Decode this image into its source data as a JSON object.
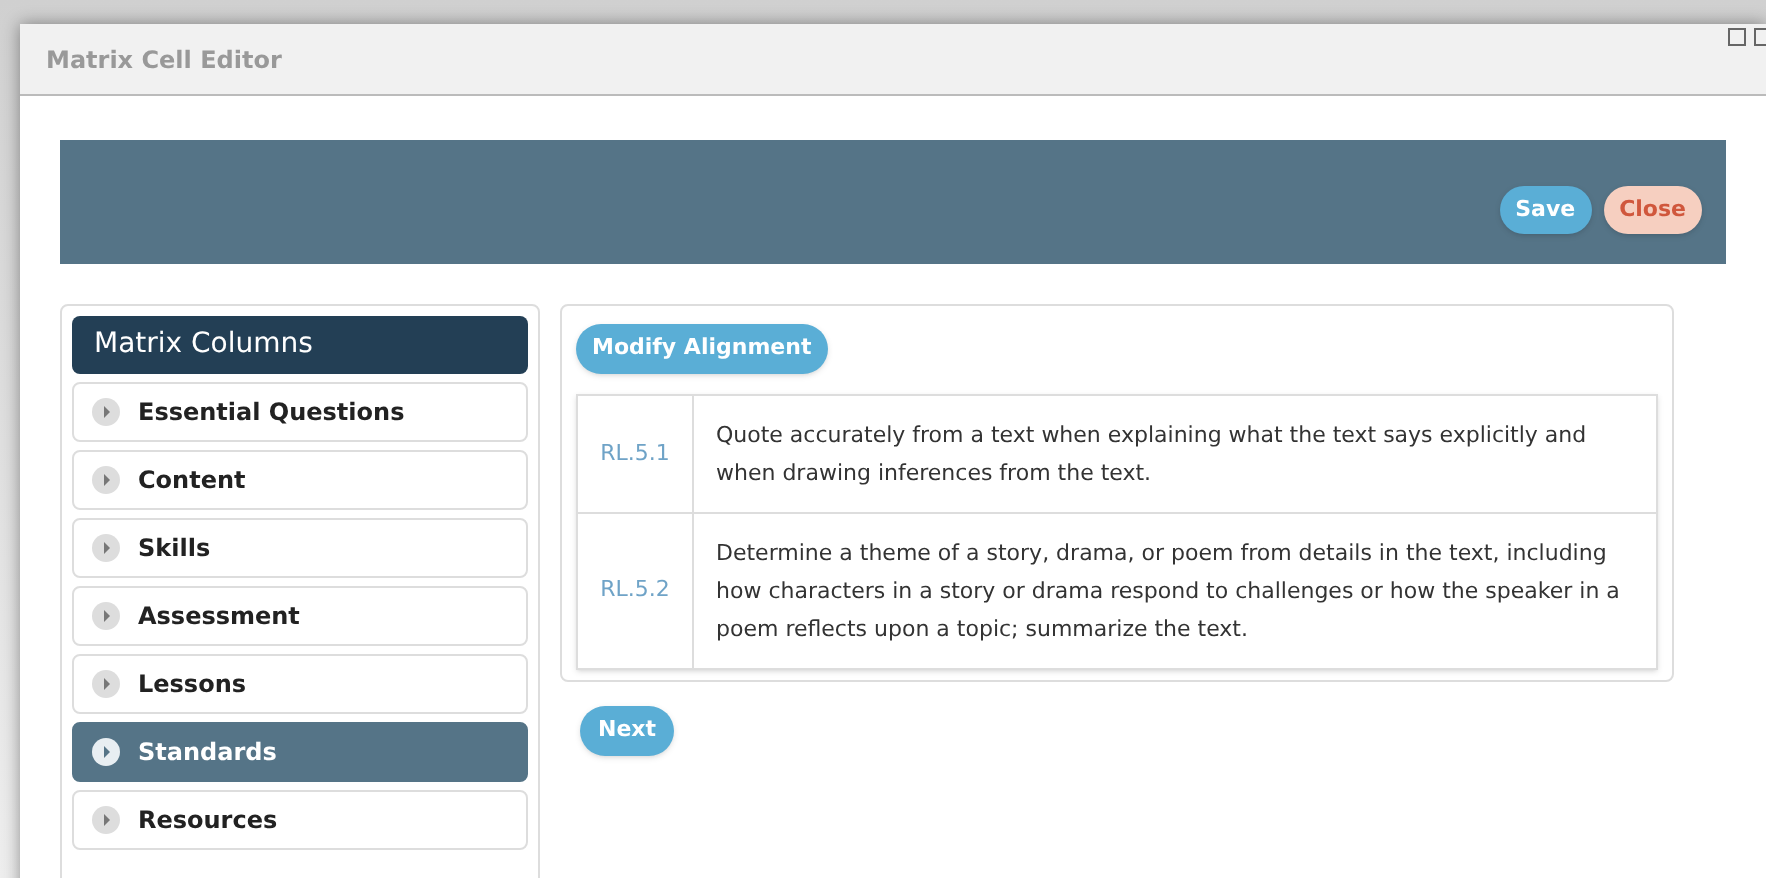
{
  "window": {
    "title": "Matrix Cell Editor"
  },
  "toolbar": {
    "buttons": [
      {
        "label": "Save",
        "kind": "primary"
      },
      {
        "label": "Close",
        "kind": "danger"
      }
    ]
  },
  "sidebar": {
    "title": "Matrix Columns",
    "items": [
      {
        "label": "Essential Questions",
        "selected": false
      },
      {
        "label": "Content",
        "selected": false
      },
      {
        "label": "Skills",
        "selected": false
      },
      {
        "label": "Assessment",
        "selected": false
      },
      {
        "label": "Lessons",
        "selected": false
      },
      {
        "label": "Standards",
        "selected": true
      },
      {
        "label": "Resources",
        "selected": false
      }
    ]
  },
  "alignment": {
    "button": "Modify Alignment",
    "rows": [
      {
        "code": "RL.5.1",
        "text": "Quote accurately from a text when explaining what the text says explicitly and when drawing inferences from the text."
      },
      {
        "code": "RL.5.2",
        "text": "Determine a theme of a story, drama, or poem from details in the text, including how characters in a story or drama respond to challenges or how the speaker in a poem reflects upon a topic; summarize the text."
      }
    ]
  },
  "next_button": "Next"
}
